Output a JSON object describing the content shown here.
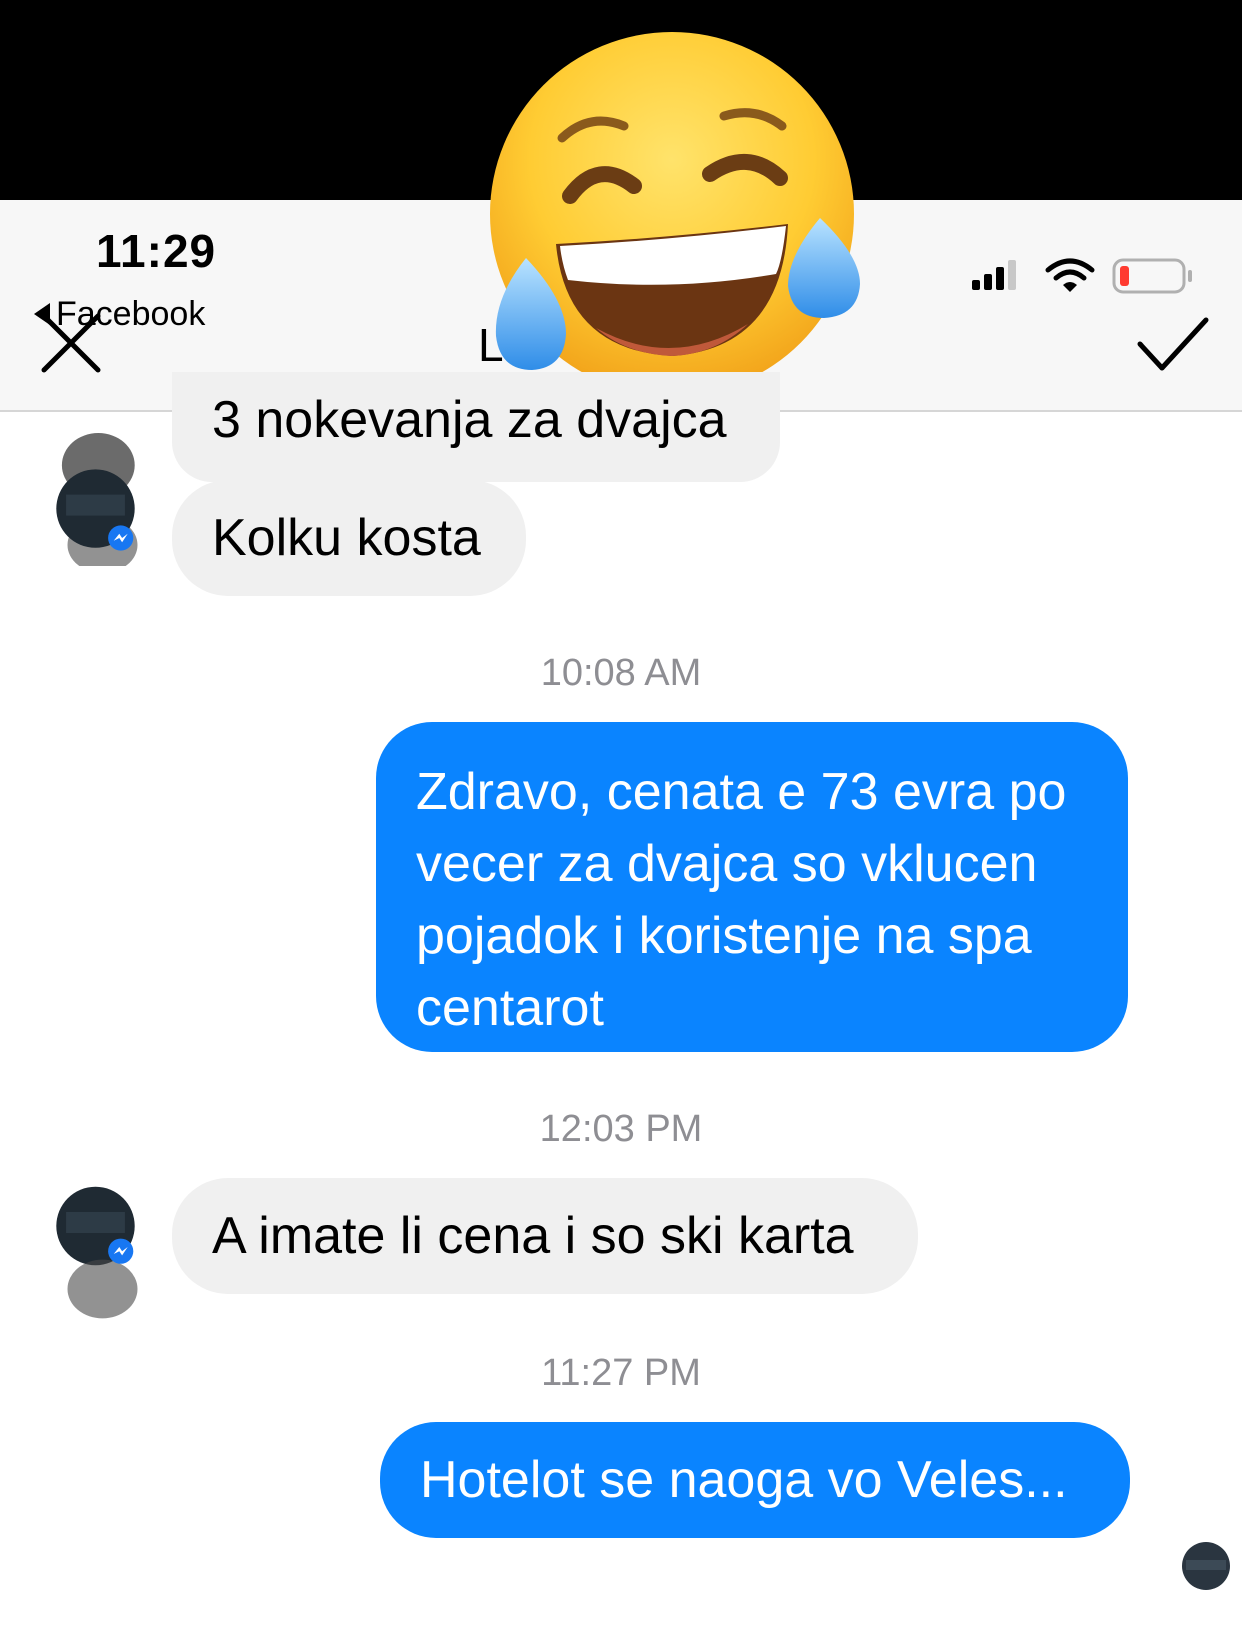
{
  "status_bar": {
    "time": "11:29",
    "back_app": "Facebook",
    "battery_color": "#ff3b30"
  },
  "header": {
    "contact_name": "L",
    "close_icon": "close-icon",
    "done_icon": "checkmark-icon"
  },
  "overlay": {
    "emoji": "face-with-tears-of-joy"
  },
  "colors": {
    "outgoing_bubble": "#0a84ff",
    "incoming_bubble": "#f0f0f0",
    "timestamp": "#8e8e93"
  },
  "messages": [
    {
      "direction": "incoming",
      "text": "3 nokevanja za dvajca"
    },
    {
      "direction": "incoming",
      "text": "Kolku kosta"
    },
    {
      "type": "timestamp",
      "text": "10:08 AM"
    },
    {
      "direction": "outgoing",
      "lines": [
        "Zdravo, cenata e 73 evra po",
        "vecer za dvajca so vklucen",
        "pojadok i koristenje na spa",
        "centarot"
      ]
    },
    {
      "type": "timestamp",
      "text": "12:03 PM"
    },
    {
      "direction": "incoming",
      "text": "A imate li cena i so ski karta"
    },
    {
      "type": "timestamp",
      "text": "11:27 PM"
    },
    {
      "direction": "outgoing",
      "text": "Hotelot se naoga vo Veles..."
    }
  ]
}
